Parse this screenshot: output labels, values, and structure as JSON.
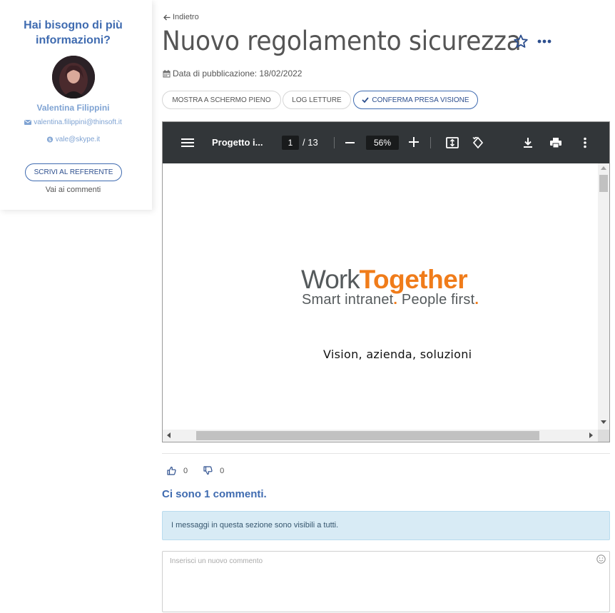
{
  "sidebar": {
    "title_line1": "Hai bisogno di più",
    "title_line2": "informazioni?",
    "referent_name": "Valentina Filippini",
    "email": "valentina.filippini@thinsoft.it",
    "skype": "vale@skype.it",
    "write_button": "SCRIVI AL REFERENTE",
    "comments_link": "Vai ai commenti"
  },
  "header": {
    "back_label": "Indietro",
    "title": "Nuovo regolamento sicurezza",
    "pub_date_label": "Data di pubblicazione: 18/02/2022"
  },
  "actions": {
    "fullscreen": "MOSTRA A SCHERMO PIENO",
    "log": "LOG LETTURE",
    "confirm": "CONFERMA PRESA VISIONE"
  },
  "pdf": {
    "doc_title": "Progetto i...",
    "current_page": "1",
    "total_pages": "/ 13",
    "zoom": "56%",
    "logo_work": "Work",
    "logo_together": "Together",
    "tagline_a": "Smart intranet",
    "tagline_dot": ".",
    "tagline_b": " People first",
    "subtitle": "Vision, azienda, soluzioni"
  },
  "reactions": {
    "likes": "0",
    "dislikes": "0"
  },
  "comments": {
    "count_label": "Ci sono 1 commenti.",
    "info": "I messaggi in questa sezione sono visibili a tutti.",
    "placeholder": "Inserisci un nuovo commento"
  },
  "colors": {
    "accent_blue": "#3f6bb0",
    "brand_orange": "#f07c1a",
    "toolbar": "#323639",
    "info_bg": "#d8ebf5"
  }
}
